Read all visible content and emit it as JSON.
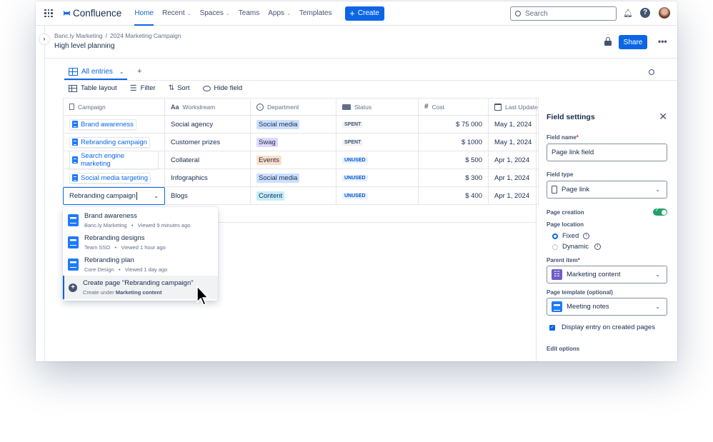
{
  "nav": {
    "brand": "Confluence",
    "items": [
      {
        "label": "Home",
        "active": true
      },
      {
        "label": "Recent",
        "chevron": true
      },
      {
        "label": "Spaces",
        "chevron": true
      },
      {
        "label": "Teams"
      },
      {
        "label": "Apps",
        "chevron": true
      },
      {
        "label": "Templates"
      }
    ],
    "create": "Create",
    "search_placeholder": "Search"
  },
  "breadcrumb": [
    "Banc.ly Marketing",
    "2024 Marketing Campaign"
  ],
  "breadcrumb_sep": "/",
  "page_title": "High level planning",
  "share": "Share",
  "view": {
    "tab": "All entries",
    "add": "+"
  },
  "toolbar": {
    "layout": "Table layout",
    "filter": "Filter",
    "sort": "Sort",
    "hide": "Hide field"
  },
  "table": {
    "columns": [
      "Campaign",
      "Workstream",
      "Department",
      "Status",
      "Cost",
      "Last Update"
    ],
    "rows": [
      {
        "campaign": "Brand awareness",
        "workstream": "Social agency",
        "department": "Social media",
        "dept_color": "#cce0ff",
        "status": "SPENT",
        "cost": "$ 75 000",
        "updated": "May 1, 2024"
      },
      {
        "campaign": "Rebranding campaign",
        "workstream": "Customer prizes",
        "department": "Swag",
        "dept_color": "#dfd8fd",
        "status": "SPENT",
        "cost": "$ 1000",
        "updated": "May 1, 2024"
      },
      {
        "campaign": "Search engine marketing",
        "workstream": "Collateral",
        "department": "Events",
        "dept_color": "#fedec8",
        "status": "UNUSED",
        "cost": "$ 500",
        "updated": "Apr 1, 2024"
      },
      {
        "campaign": "Social media targeting",
        "workstream": "Infographics",
        "department": "Social media",
        "dept_color": "#cce0ff",
        "status": "UNUSED",
        "cost": "$ 300",
        "updated": "Apr 1, 2024"
      },
      {
        "campaign": "Rebranding campaign",
        "editing": true,
        "workstream": "Blogs",
        "department": "Content",
        "dept_color": "#c6edfb",
        "status": "UNUSED",
        "cost": "$ 400",
        "updated": "Apr 1, 2024"
      }
    ]
  },
  "dropdown": {
    "items": [
      {
        "title": "Brand awareness",
        "space": "Banc.ly Marketing",
        "viewed": "Viewed 9 minutes ago"
      },
      {
        "title": "Rebranding designs",
        "space": "Team SSO",
        "viewed": "Viewed 1 hour ago"
      },
      {
        "title": "Rebranding plan",
        "space": "Core Design",
        "viewed": "Viewed 1 day ago"
      }
    ],
    "create": {
      "title": "Create page \"Rebranding campaign\"",
      "sub_prefix": "Create under",
      "sub_target": "Marketing content"
    },
    "sep": "•"
  },
  "panel": {
    "title": "Field settings",
    "field_name_label": "Field name",
    "field_name": "Page link field",
    "field_type_label": "Field type",
    "field_type": "Page link",
    "page_creation": "Page creation",
    "page_creation_on": true,
    "page_location": "Page location",
    "loc_options": [
      "Fixed",
      "Dynamic"
    ],
    "loc_selected": "Fixed",
    "parent_label": "Parent item",
    "parent": "Marketing content",
    "template_label": "Page template (optional)",
    "template": "Meeting notes",
    "display_entry": "Display entry on created pages",
    "display_checked": true,
    "edit_options": "Edit options",
    "required": "*"
  },
  "colors": {
    "accent": "#0c66e4",
    "toggle": "#22a06b",
    "required": "#c9372c"
  }
}
